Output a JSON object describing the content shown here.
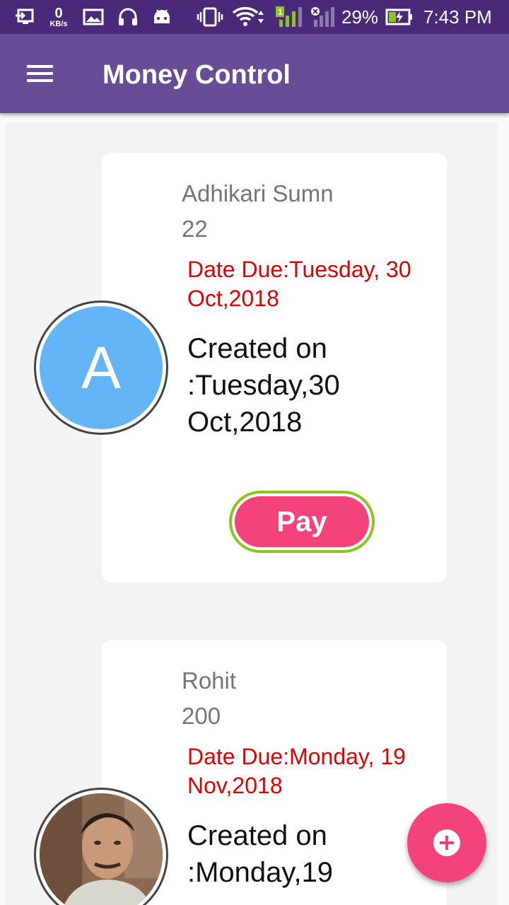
{
  "status_bar": {
    "network_speed_value": "0",
    "network_speed_unit": "KB/s",
    "sim1_badge": "1",
    "battery_percent": "29%",
    "time": "7:43 PM",
    "icons": [
      "usb-debug-icon",
      "gallery-icon",
      "headset-icon",
      "android-icon",
      "vibrate-icon",
      "wifi-icon",
      "signal-sim1-icon",
      "signal-sim2-no-service-icon",
      "battery-charging-icon"
    ]
  },
  "app_bar": {
    "title": "Money Control",
    "menu_icon": "hamburger-menu-icon"
  },
  "records": [
    {
      "avatar_letter": "A",
      "avatar_color": "#64b5f6",
      "name": "Adhikari Sumn",
      "amount": "22",
      "due": "Date Due:Tuesday, 30 Oct,2018",
      "created": "Created on :Tuesday,30 Oct,2018",
      "pay_label": "Pay"
    },
    {
      "avatar_type": "photo",
      "name": "Rohit",
      "amount": "200",
      "due": "Date Due:Monday, 19 Nov,2018",
      "created": "Created on :Monday,19"
    }
  ],
  "fab": {
    "icon": "add-icon"
  },
  "colors": {
    "status_bar": "#4a2a78",
    "app_bar": "#674c96",
    "due_text": "#e00000",
    "pay_button": "#f4437b",
    "pay_button_border": "#8cc51e",
    "fab": "#f4437b"
  }
}
